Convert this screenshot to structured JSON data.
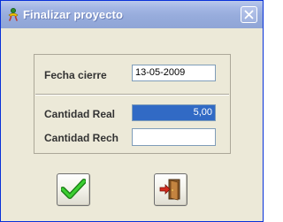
{
  "window": {
    "title": "Finalizar proyecto"
  },
  "icons": {
    "app": "person-icon",
    "close": "close-icon",
    "accept": "checkmark-icon",
    "exit": "exit-door-icon"
  },
  "form": {
    "fecha_cierre": {
      "label": "Fecha cierre",
      "value": "13-05-2009"
    },
    "cantidad_real": {
      "label": "Cantidad Real",
      "value": "5,00"
    },
    "cantidad_rech": {
      "label": "Cantidad Rech",
      "value": ""
    }
  },
  "colors": {
    "titlebar": "#a3b6e4",
    "selection": "#316ac5",
    "accept_green": "#22a31c",
    "exit_red": "#d42a1c",
    "face": "#ece9d8"
  }
}
